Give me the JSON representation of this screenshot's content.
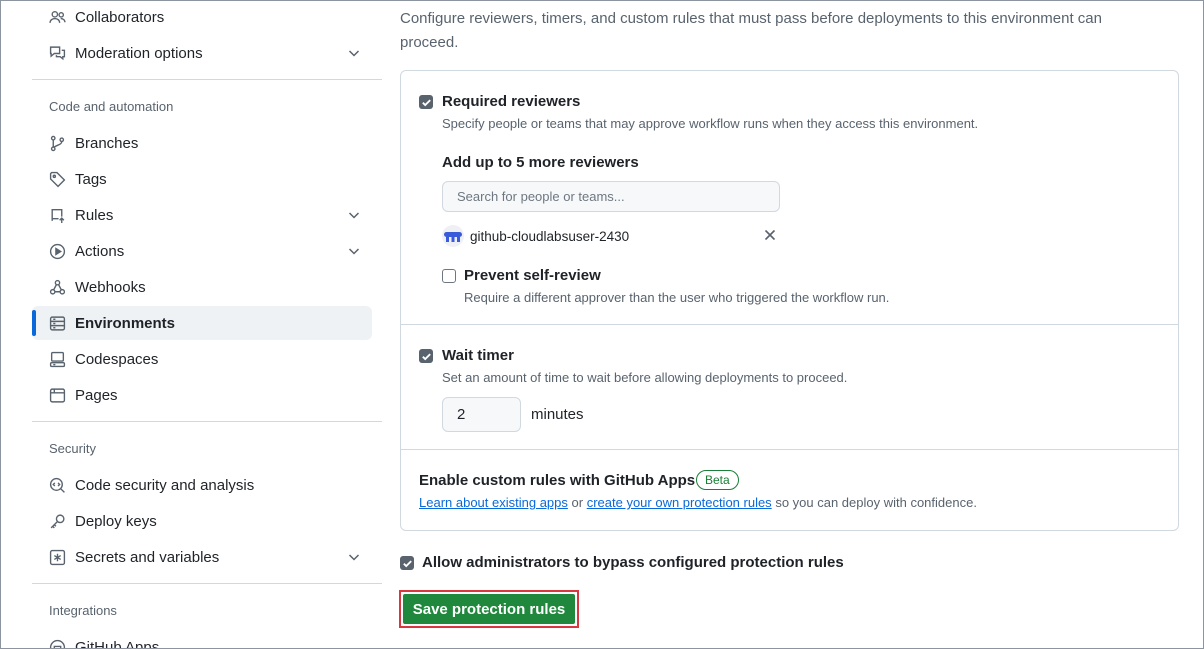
{
  "sidebar": {
    "top_items": [
      {
        "label": "Collaborators",
        "icon": "people-icon"
      },
      {
        "label": "Moderation options",
        "icon": "comment-discussion-icon"
      }
    ],
    "sections": [
      {
        "title": "Code and automation"
      },
      {
        "title": "Security"
      },
      {
        "title": "Integrations"
      }
    ],
    "code_items": [
      {
        "label": "Branches",
        "icon": "git-branch-icon"
      },
      {
        "label": "Tags",
        "icon": "tag-icon"
      },
      {
        "label": "Rules",
        "icon": "repo-push-icon"
      },
      {
        "label": "Actions",
        "icon": "play-icon"
      },
      {
        "label": "Webhooks",
        "icon": "webhook-icon"
      },
      {
        "label": "Environments",
        "icon": "server-icon",
        "active": true
      },
      {
        "label": "Codespaces",
        "icon": "codespaces-icon"
      },
      {
        "label": "Pages",
        "icon": "browser-icon"
      }
    ],
    "security_items": [
      {
        "label": "Code security and analysis",
        "icon": "codescan-icon"
      },
      {
        "label": "Deploy keys",
        "icon": "key-icon"
      },
      {
        "label": "Secrets and variables",
        "icon": "asterisk-icon"
      }
    ],
    "integration_items": [
      {
        "label": "GitHub Apps",
        "icon": "apps-icon"
      }
    ]
  },
  "main": {
    "description": "Configure reviewers, timers, and custom rules that must pass before deployments to this environment can proceed.",
    "required_reviewers": {
      "label": "Required reviewers",
      "checked": true,
      "note": "Specify people or teams that may approve workflow runs when they access this environment.",
      "add_label": "Add up to 5 more reviewers",
      "search_placeholder": "Search for people or teams...",
      "reviewer_name": "github-cloudlabsuser-2430",
      "prevent_self_review": {
        "label": "Prevent self-review",
        "checked": false,
        "note": "Require a different approver than the user who triggered the workflow run."
      }
    },
    "wait_timer": {
      "label": "Wait timer",
      "checked": true,
      "note": "Set an amount of time to wait before allowing deployments to proceed.",
      "value": "2",
      "unit": "minutes"
    },
    "custom_rules": {
      "label": "Enable custom rules with GitHub Apps",
      "badge": "Beta",
      "link1": "Learn about existing apps",
      "or": "or",
      "link2": "create your own protection rules",
      "tail": "so you can deploy with confidence."
    },
    "allow_admins": {
      "label": "Allow administrators to bypass configured protection rules",
      "checked": true
    },
    "save_button": "Save protection rules"
  },
  "colors": {
    "accent": "#0969da",
    "save_green": "#1f883d",
    "highlight_red": "#d9363e",
    "beta_green": "#1a7f37"
  }
}
